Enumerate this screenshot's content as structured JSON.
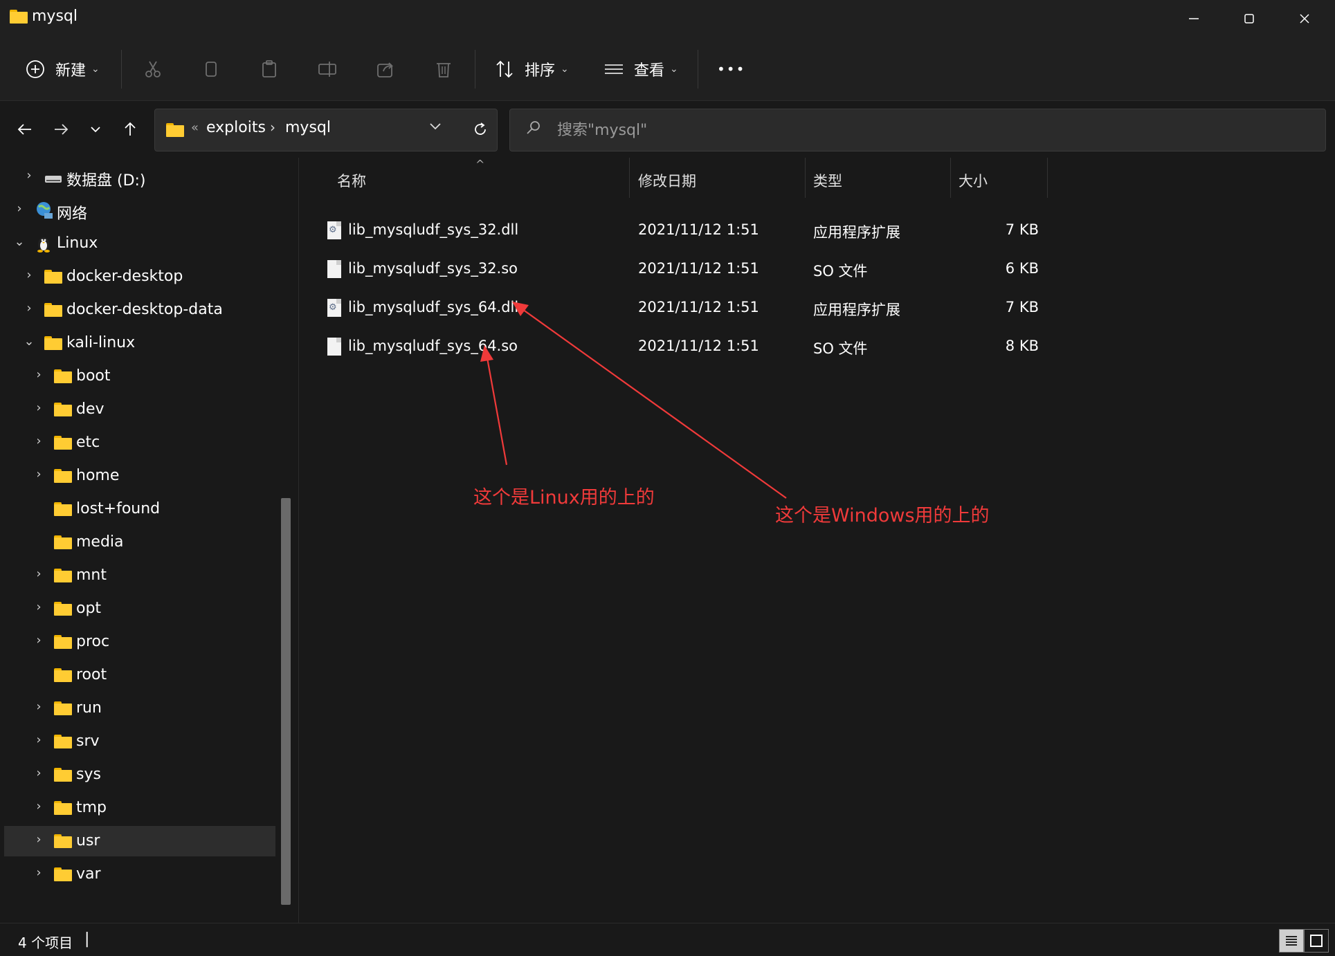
{
  "window": {
    "title": "mysql",
    "minimize_icon": "minimize-icon",
    "maximize_icon": "maximize-icon",
    "close_icon": "close-icon"
  },
  "toolbar": {
    "new_label": "新建",
    "sort_label": "排序",
    "view_label": "查看",
    "more_label": "•••"
  },
  "address": {
    "crumbs": [
      "exploits",
      "mysql"
    ],
    "overflow": "«"
  },
  "search": {
    "placeholder": "搜索\"mysql\""
  },
  "sidebar": {
    "items": [
      {
        "label": "数据盘 (D:)",
        "icon": "drive-icon"
      },
      {
        "label": "网络",
        "icon": "network-icon"
      },
      {
        "label": "Linux",
        "icon": "linux-icon"
      },
      {
        "label": "docker-desktop",
        "icon": "folder-icon"
      },
      {
        "label": "docker-desktop-data",
        "icon": "folder-icon"
      },
      {
        "label": "kali-linux",
        "icon": "folder-icon"
      },
      {
        "label": "boot",
        "icon": "folder-icon"
      },
      {
        "label": "dev",
        "icon": "folder-icon"
      },
      {
        "label": "etc",
        "icon": "folder-icon"
      },
      {
        "label": "home",
        "icon": "folder-icon"
      },
      {
        "label": "lost+found",
        "icon": "folder-icon"
      },
      {
        "label": "media",
        "icon": "folder-icon"
      },
      {
        "label": "mnt",
        "icon": "folder-icon"
      },
      {
        "label": "opt",
        "icon": "folder-icon"
      },
      {
        "label": "proc",
        "icon": "folder-icon"
      },
      {
        "label": "root",
        "icon": "folder-icon"
      },
      {
        "label": "run",
        "icon": "folder-icon"
      },
      {
        "label": "srv",
        "icon": "folder-icon"
      },
      {
        "label": "sys",
        "icon": "folder-icon"
      },
      {
        "label": "tmp",
        "icon": "folder-icon"
      },
      {
        "label": "usr",
        "icon": "folder-icon"
      },
      {
        "label": "var",
        "icon": "folder-icon"
      }
    ]
  },
  "columns": {
    "name": "名称",
    "date": "修改日期",
    "type": "类型",
    "size": "大小"
  },
  "files": [
    {
      "name": "lib_mysqludf_sys_32.dll",
      "date": "2021/11/12 1:51",
      "type": "应用程序扩展",
      "size": "7 KB"
    },
    {
      "name": "lib_mysqludf_sys_32.so",
      "date": "2021/11/12 1:51",
      "type": "SO 文件",
      "size": "6 KB"
    },
    {
      "name": "lib_mysqludf_sys_64.dll",
      "date": "2021/11/12 1:51",
      "type": "应用程序扩展",
      "size": "7 KB"
    },
    {
      "name": "lib_mysqludf_sys_64.so",
      "date": "2021/11/12 1:51",
      "type": "SO 文件",
      "size": "8 KB"
    }
  ],
  "annotations": {
    "linux_note": "这个是Linux用的上的",
    "windows_note": "这个是Windows用的上的",
    "color": "#f03a3a"
  },
  "status": {
    "item_count": "4 个项目",
    "caret": "|"
  }
}
